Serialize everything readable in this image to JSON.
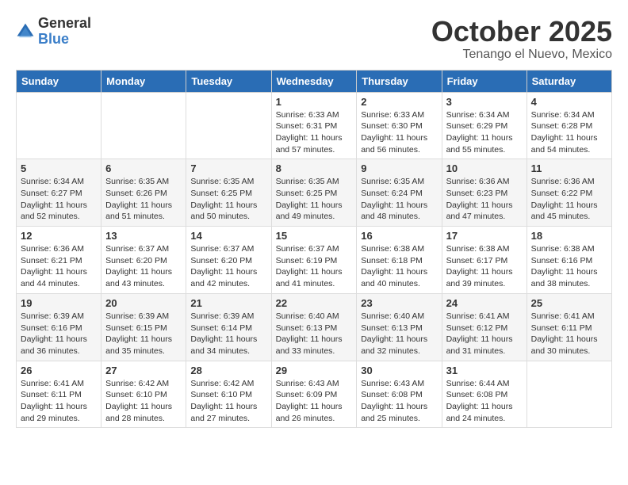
{
  "logo": {
    "general": "General",
    "blue": "Blue"
  },
  "header": {
    "month": "October 2025",
    "location": "Tenango el Nuevo, Mexico"
  },
  "weekdays": [
    "Sunday",
    "Monday",
    "Tuesday",
    "Wednesday",
    "Thursday",
    "Friday",
    "Saturday"
  ],
  "weeks": [
    [
      {
        "day": "",
        "sunrise": "",
        "sunset": "",
        "daylight": ""
      },
      {
        "day": "",
        "sunrise": "",
        "sunset": "",
        "daylight": ""
      },
      {
        "day": "",
        "sunrise": "",
        "sunset": "",
        "daylight": ""
      },
      {
        "day": "1",
        "sunrise": "Sunrise: 6:33 AM",
        "sunset": "Sunset: 6:31 PM",
        "daylight": "Daylight: 11 hours and 57 minutes."
      },
      {
        "day": "2",
        "sunrise": "Sunrise: 6:33 AM",
        "sunset": "Sunset: 6:30 PM",
        "daylight": "Daylight: 11 hours and 56 minutes."
      },
      {
        "day": "3",
        "sunrise": "Sunrise: 6:34 AM",
        "sunset": "Sunset: 6:29 PM",
        "daylight": "Daylight: 11 hours and 55 minutes."
      },
      {
        "day": "4",
        "sunrise": "Sunrise: 6:34 AM",
        "sunset": "Sunset: 6:28 PM",
        "daylight": "Daylight: 11 hours and 54 minutes."
      }
    ],
    [
      {
        "day": "5",
        "sunrise": "Sunrise: 6:34 AM",
        "sunset": "Sunset: 6:27 PM",
        "daylight": "Daylight: 11 hours and 52 minutes."
      },
      {
        "day": "6",
        "sunrise": "Sunrise: 6:35 AM",
        "sunset": "Sunset: 6:26 PM",
        "daylight": "Daylight: 11 hours and 51 minutes."
      },
      {
        "day": "7",
        "sunrise": "Sunrise: 6:35 AM",
        "sunset": "Sunset: 6:25 PM",
        "daylight": "Daylight: 11 hours and 50 minutes."
      },
      {
        "day": "8",
        "sunrise": "Sunrise: 6:35 AM",
        "sunset": "Sunset: 6:25 PM",
        "daylight": "Daylight: 11 hours and 49 minutes."
      },
      {
        "day": "9",
        "sunrise": "Sunrise: 6:35 AM",
        "sunset": "Sunset: 6:24 PM",
        "daylight": "Daylight: 11 hours and 48 minutes."
      },
      {
        "day": "10",
        "sunrise": "Sunrise: 6:36 AM",
        "sunset": "Sunset: 6:23 PM",
        "daylight": "Daylight: 11 hours and 47 minutes."
      },
      {
        "day": "11",
        "sunrise": "Sunrise: 6:36 AM",
        "sunset": "Sunset: 6:22 PM",
        "daylight": "Daylight: 11 hours and 45 minutes."
      }
    ],
    [
      {
        "day": "12",
        "sunrise": "Sunrise: 6:36 AM",
        "sunset": "Sunset: 6:21 PM",
        "daylight": "Daylight: 11 hours and 44 minutes."
      },
      {
        "day": "13",
        "sunrise": "Sunrise: 6:37 AM",
        "sunset": "Sunset: 6:20 PM",
        "daylight": "Daylight: 11 hours and 43 minutes."
      },
      {
        "day": "14",
        "sunrise": "Sunrise: 6:37 AM",
        "sunset": "Sunset: 6:20 PM",
        "daylight": "Daylight: 11 hours and 42 minutes."
      },
      {
        "day": "15",
        "sunrise": "Sunrise: 6:37 AM",
        "sunset": "Sunset: 6:19 PM",
        "daylight": "Daylight: 11 hours and 41 minutes."
      },
      {
        "day": "16",
        "sunrise": "Sunrise: 6:38 AM",
        "sunset": "Sunset: 6:18 PM",
        "daylight": "Daylight: 11 hours and 40 minutes."
      },
      {
        "day": "17",
        "sunrise": "Sunrise: 6:38 AM",
        "sunset": "Sunset: 6:17 PM",
        "daylight": "Daylight: 11 hours and 39 minutes."
      },
      {
        "day": "18",
        "sunrise": "Sunrise: 6:38 AM",
        "sunset": "Sunset: 6:16 PM",
        "daylight": "Daylight: 11 hours and 38 minutes."
      }
    ],
    [
      {
        "day": "19",
        "sunrise": "Sunrise: 6:39 AM",
        "sunset": "Sunset: 6:16 PM",
        "daylight": "Daylight: 11 hours and 36 minutes."
      },
      {
        "day": "20",
        "sunrise": "Sunrise: 6:39 AM",
        "sunset": "Sunset: 6:15 PM",
        "daylight": "Daylight: 11 hours and 35 minutes."
      },
      {
        "day": "21",
        "sunrise": "Sunrise: 6:39 AM",
        "sunset": "Sunset: 6:14 PM",
        "daylight": "Daylight: 11 hours and 34 minutes."
      },
      {
        "day": "22",
        "sunrise": "Sunrise: 6:40 AM",
        "sunset": "Sunset: 6:13 PM",
        "daylight": "Daylight: 11 hours and 33 minutes."
      },
      {
        "day": "23",
        "sunrise": "Sunrise: 6:40 AM",
        "sunset": "Sunset: 6:13 PM",
        "daylight": "Daylight: 11 hours and 32 minutes."
      },
      {
        "day": "24",
        "sunrise": "Sunrise: 6:41 AM",
        "sunset": "Sunset: 6:12 PM",
        "daylight": "Daylight: 11 hours and 31 minutes."
      },
      {
        "day": "25",
        "sunrise": "Sunrise: 6:41 AM",
        "sunset": "Sunset: 6:11 PM",
        "daylight": "Daylight: 11 hours and 30 minutes."
      }
    ],
    [
      {
        "day": "26",
        "sunrise": "Sunrise: 6:41 AM",
        "sunset": "Sunset: 6:11 PM",
        "daylight": "Daylight: 11 hours and 29 minutes."
      },
      {
        "day": "27",
        "sunrise": "Sunrise: 6:42 AM",
        "sunset": "Sunset: 6:10 PM",
        "daylight": "Daylight: 11 hours and 28 minutes."
      },
      {
        "day": "28",
        "sunrise": "Sunrise: 6:42 AM",
        "sunset": "Sunset: 6:10 PM",
        "daylight": "Daylight: 11 hours and 27 minutes."
      },
      {
        "day": "29",
        "sunrise": "Sunrise: 6:43 AM",
        "sunset": "Sunset: 6:09 PM",
        "daylight": "Daylight: 11 hours and 26 minutes."
      },
      {
        "day": "30",
        "sunrise": "Sunrise: 6:43 AM",
        "sunset": "Sunset: 6:08 PM",
        "daylight": "Daylight: 11 hours and 25 minutes."
      },
      {
        "day": "31",
        "sunrise": "Sunrise: 6:44 AM",
        "sunset": "Sunset: 6:08 PM",
        "daylight": "Daylight: 11 hours and 24 minutes."
      },
      {
        "day": "",
        "sunrise": "",
        "sunset": "",
        "daylight": ""
      }
    ]
  ]
}
